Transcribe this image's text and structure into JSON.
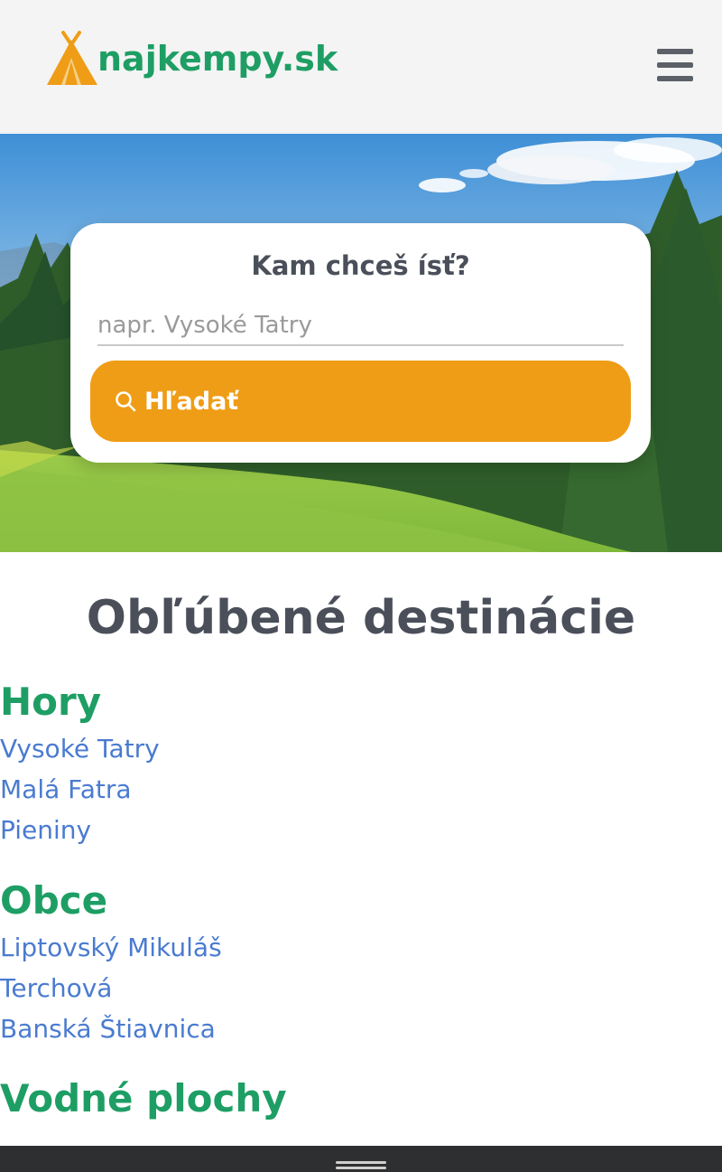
{
  "header": {
    "logo_text": "najkempy.sk",
    "logo_icon": "tent-icon",
    "menu_icon": "hamburger-menu-icon"
  },
  "hero": {
    "background": "forest and meadow photo",
    "search": {
      "title": "Kam chceš ísť?",
      "placeholder": "napr. Vysoké Tatry",
      "value": "",
      "button_label": "Hľadať",
      "button_icon": "search-icon"
    }
  },
  "destinations": {
    "heading": "Obľúbené destinácie",
    "groups": [
      {
        "title": "Hory",
        "items": [
          "Vysoké Tatry",
          "Malá Fatra",
          "Pieniny"
        ]
      },
      {
        "title": "Obce",
        "items": [
          "Liptovský Mikuláš",
          "Terchová",
          "Banská Štiavnica"
        ]
      },
      {
        "title": "Vodné plochy",
        "items": []
      }
    ]
  },
  "colors": {
    "brand_green": "#1e9e64",
    "accent_orange": "#ef9d16",
    "link_blue": "#4a7bd0",
    "heading_gray": "#4a4f5a"
  }
}
